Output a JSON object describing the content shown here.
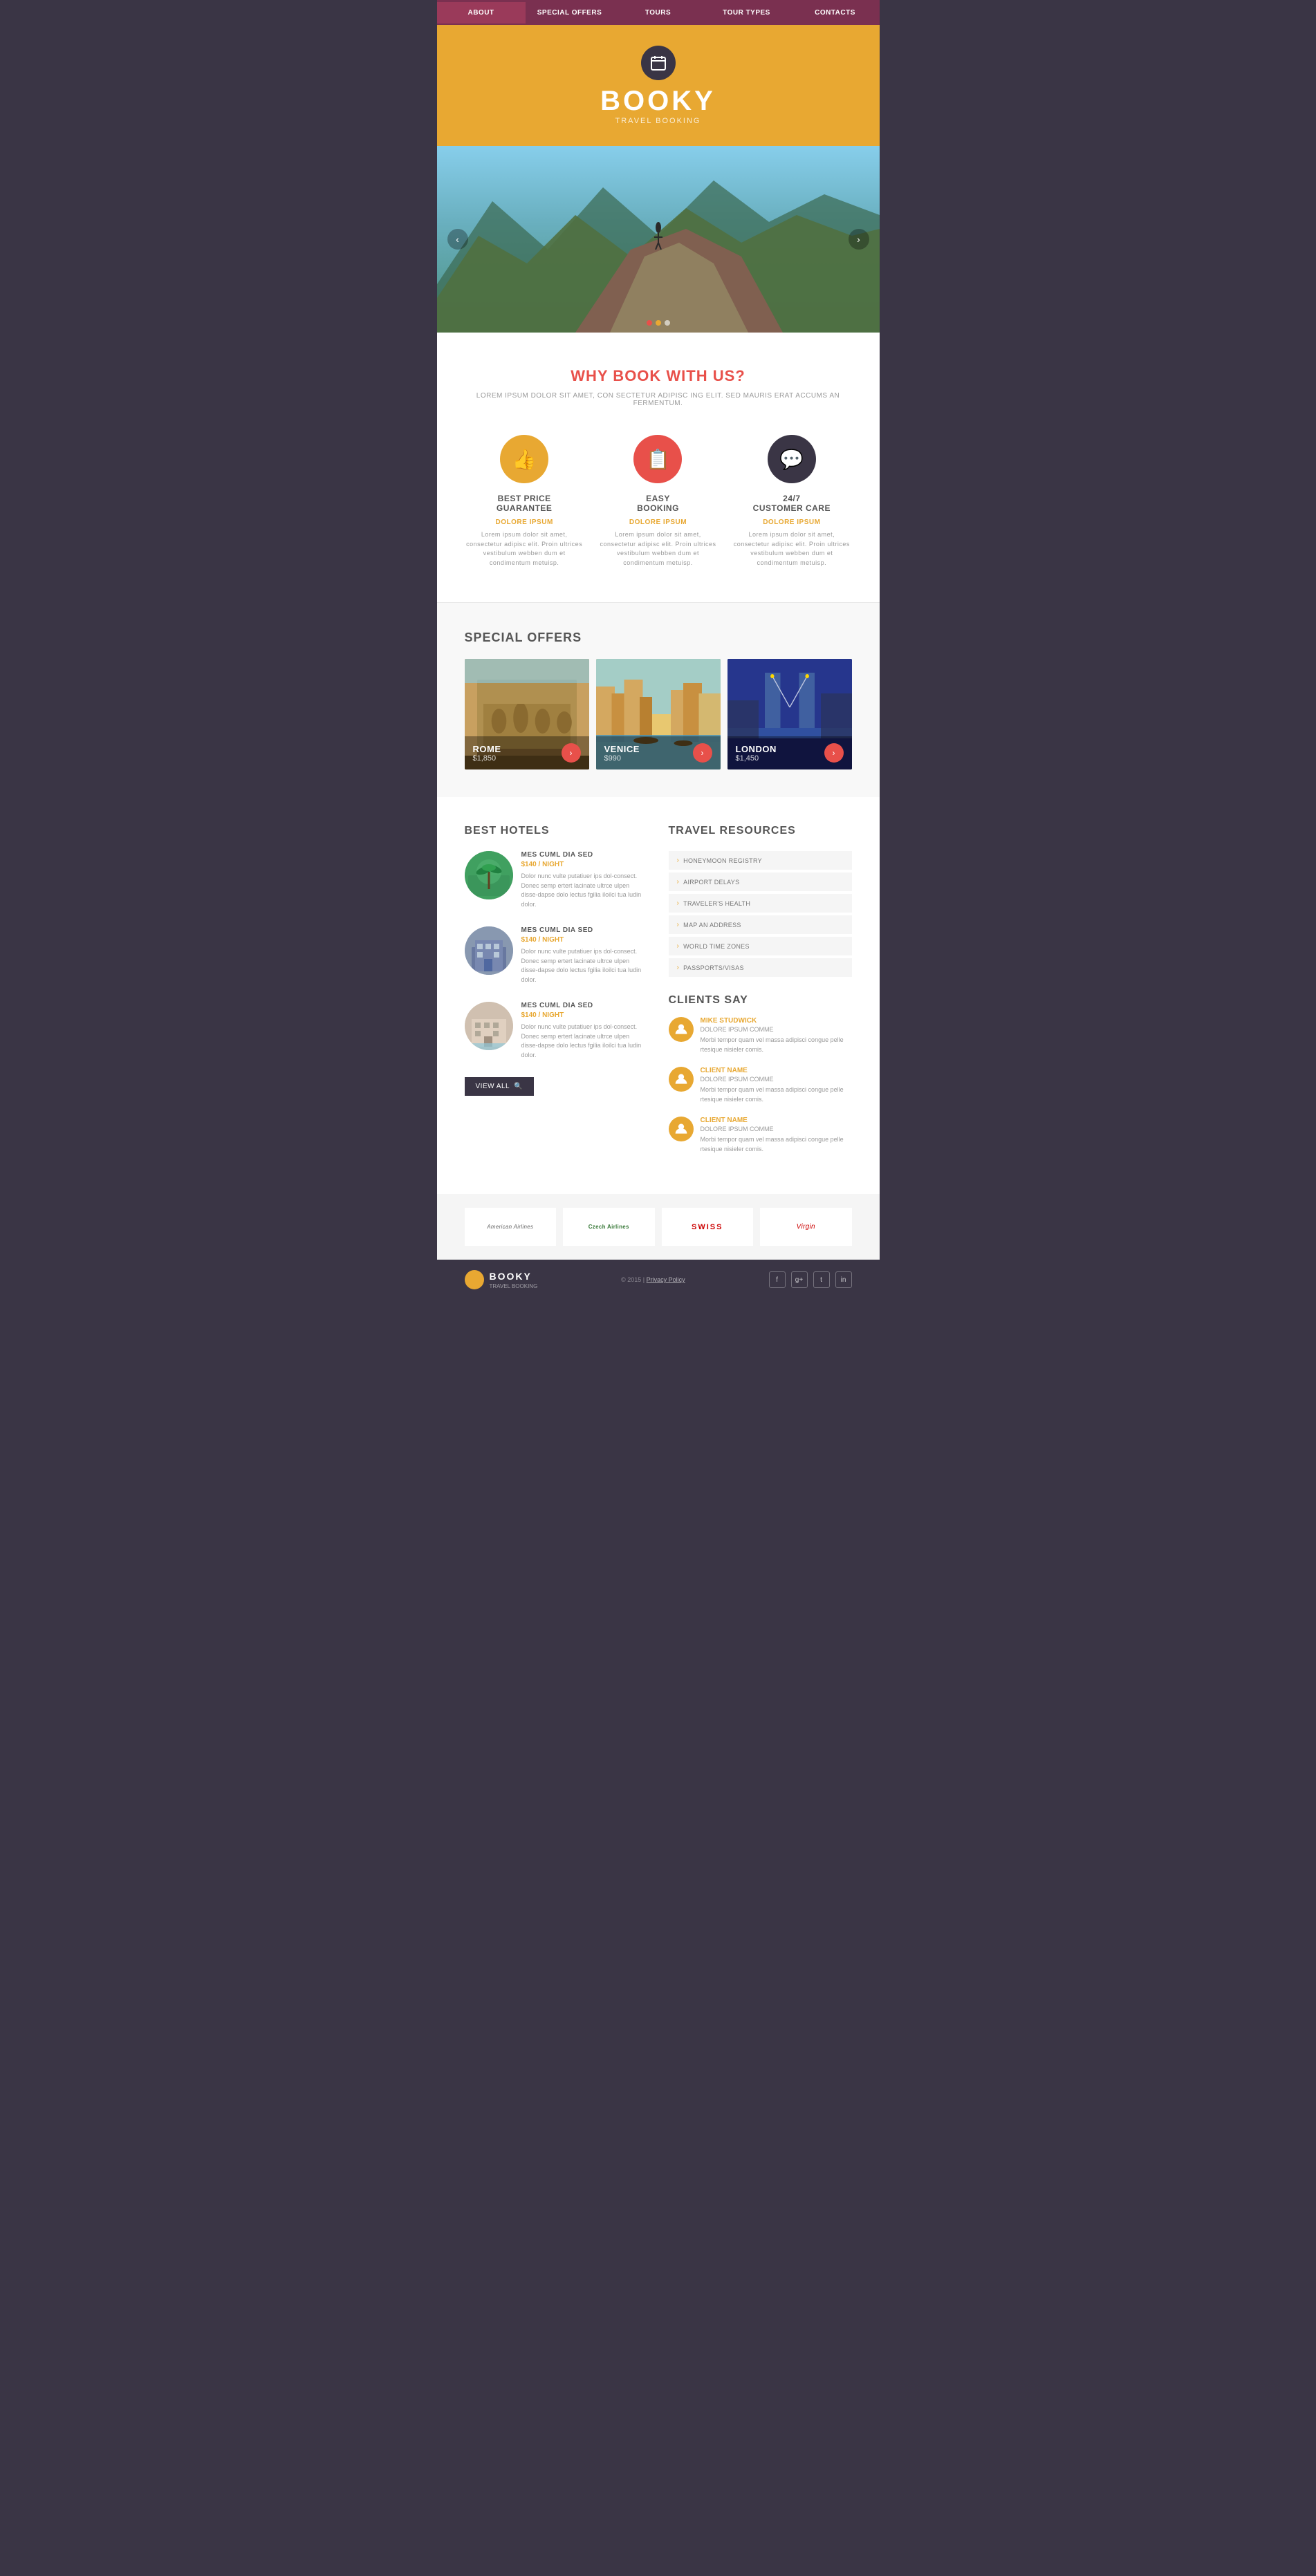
{
  "nav": {
    "items": [
      {
        "label": "ABOUT",
        "active": true
      },
      {
        "label": "SPECIAL OFFERS",
        "active": false
      },
      {
        "label": "TOURS",
        "active": false
      },
      {
        "label": "TOUR TYPES",
        "active": false
      },
      {
        "label": "CONTACTS",
        "active": false
      }
    ]
  },
  "header": {
    "title": "BOOKY",
    "subtitle": "TRAVEL BOOKING"
  },
  "why_book": {
    "title": "WHY BOOK WITH US?",
    "subtitle": "LOREM IPSUM DOLOR SIT AMET, CON SECTETUR ADIPISC ING ELIT. SED MAURIS ERAT ACCUMS AN FERMENTUM.",
    "features": [
      {
        "icon": "👍",
        "title": "BEST PRICE\nGUARANTEE",
        "dolore": "DOLORE IPSUM",
        "desc": "Lorem ipsum dolor sit amet, consectetur adipisc elit. Proin ultrices vestibulum webben dum et condimentum metuisp."
      },
      {
        "icon": "📋",
        "title": "EASY\nBOOKING",
        "dolore": "DOLORE IPSUM",
        "desc": "Lorem ipsum dolor sit amet, consectetur adipisc elit. Proin ultrices vestibulum webben dum et condimentum metuisp."
      },
      {
        "icon": "💬",
        "title": "24/7\nCUSTOMER CARE",
        "dolore": "DOLORE IPSUM",
        "desc": "Lorem ipsum dolor sit amet, consectetur adipisc elit. Proin ultrices vestibulum webben dum et condimentum metuisp."
      }
    ]
  },
  "special_offers": {
    "title": "SPECIAL OFFERS",
    "offers": [
      {
        "name": "ROME",
        "price": "$1,850"
      },
      {
        "name": "VENICE",
        "price": "$990"
      },
      {
        "name": "LONDON",
        "price": "$1,450"
      }
    ]
  },
  "best_hotels": {
    "title": "BEST HOTELS",
    "hotels": [
      {
        "name": "MES CUML DIA SED",
        "price": "$140",
        "price_label": "/ NIGHT",
        "desc": "Dolor nunc vulte putatiuer ips dol-consect. Donec semp ertert lacinate ultrce ulpen disse-dapse dolo lectus fgilia iloilci tua ludin dolor."
      },
      {
        "name": "MES CUML DIA SED",
        "price": "$140",
        "price_label": "/ NIGHT",
        "desc": "Dolor nunc vulte putatiuer ips dol-consect. Donec semp ertert lacinate ultrce ulpen disse-dapse dolo lectus fgilia iloilci tua ludin dolor."
      },
      {
        "name": "MES CUML DIA SED",
        "price": "$140",
        "price_label": "/ NIGHT",
        "desc": "Dolor nunc vulte putatiuer ips dol-consect. Donec semp ertert lacinate ultrce ulpen disse-dapse dolo lectus fgilia iloilci tua ludin dolor."
      }
    ],
    "view_all": "VIEW ALL"
  },
  "travel_resources": {
    "title": "TRAVEL RESOURCES",
    "items": [
      "HONEYMOON REGISTRY",
      "AIRPORT DELAYS",
      "TRAVELER'S HEALTH",
      "MAP AN ADDRESS",
      "WORLD TIME ZONES",
      "PASSPORTS/VISAS"
    ]
  },
  "clients_say": {
    "title": "CLIENTS SAY",
    "clients": [
      {
        "name": "MIKE STUDWICK",
        "sub": "DOLORE IPSUM COMME",
        "text": "Morbi tempor quam vel massa adipisci congue pelle rtesique nisieler comis."
      },
      {
        "name": "CLIENT NAME",
        "sub": "DOLORE IPSUM COMME",
        "text": "Morbi tempor quam vel massa adipisci congue pelle rtesique nisieler comis."
      },
      {
        "name": "CLIENT NAME",
        "sub": "DOLORE IPSUM COMME",
        "text": "Morbi tempor quam vel massa adipisci congue pelle rtesique nisieler comis."
      }
    ]
  },
  "airlines": [
    "American Airlines",
    "Czech Airlines",
    "SWISS",
    "Virgin"
  ],
  "footer": {
    "brand": "BOOKY",
    "subtitle": "TRAVEL BOOKING",
    "copy": "© 2015 | Privacy Policy",
    "social": [
      "f",
      "g+",
      "t",
      "in"
    ]
  }
}
